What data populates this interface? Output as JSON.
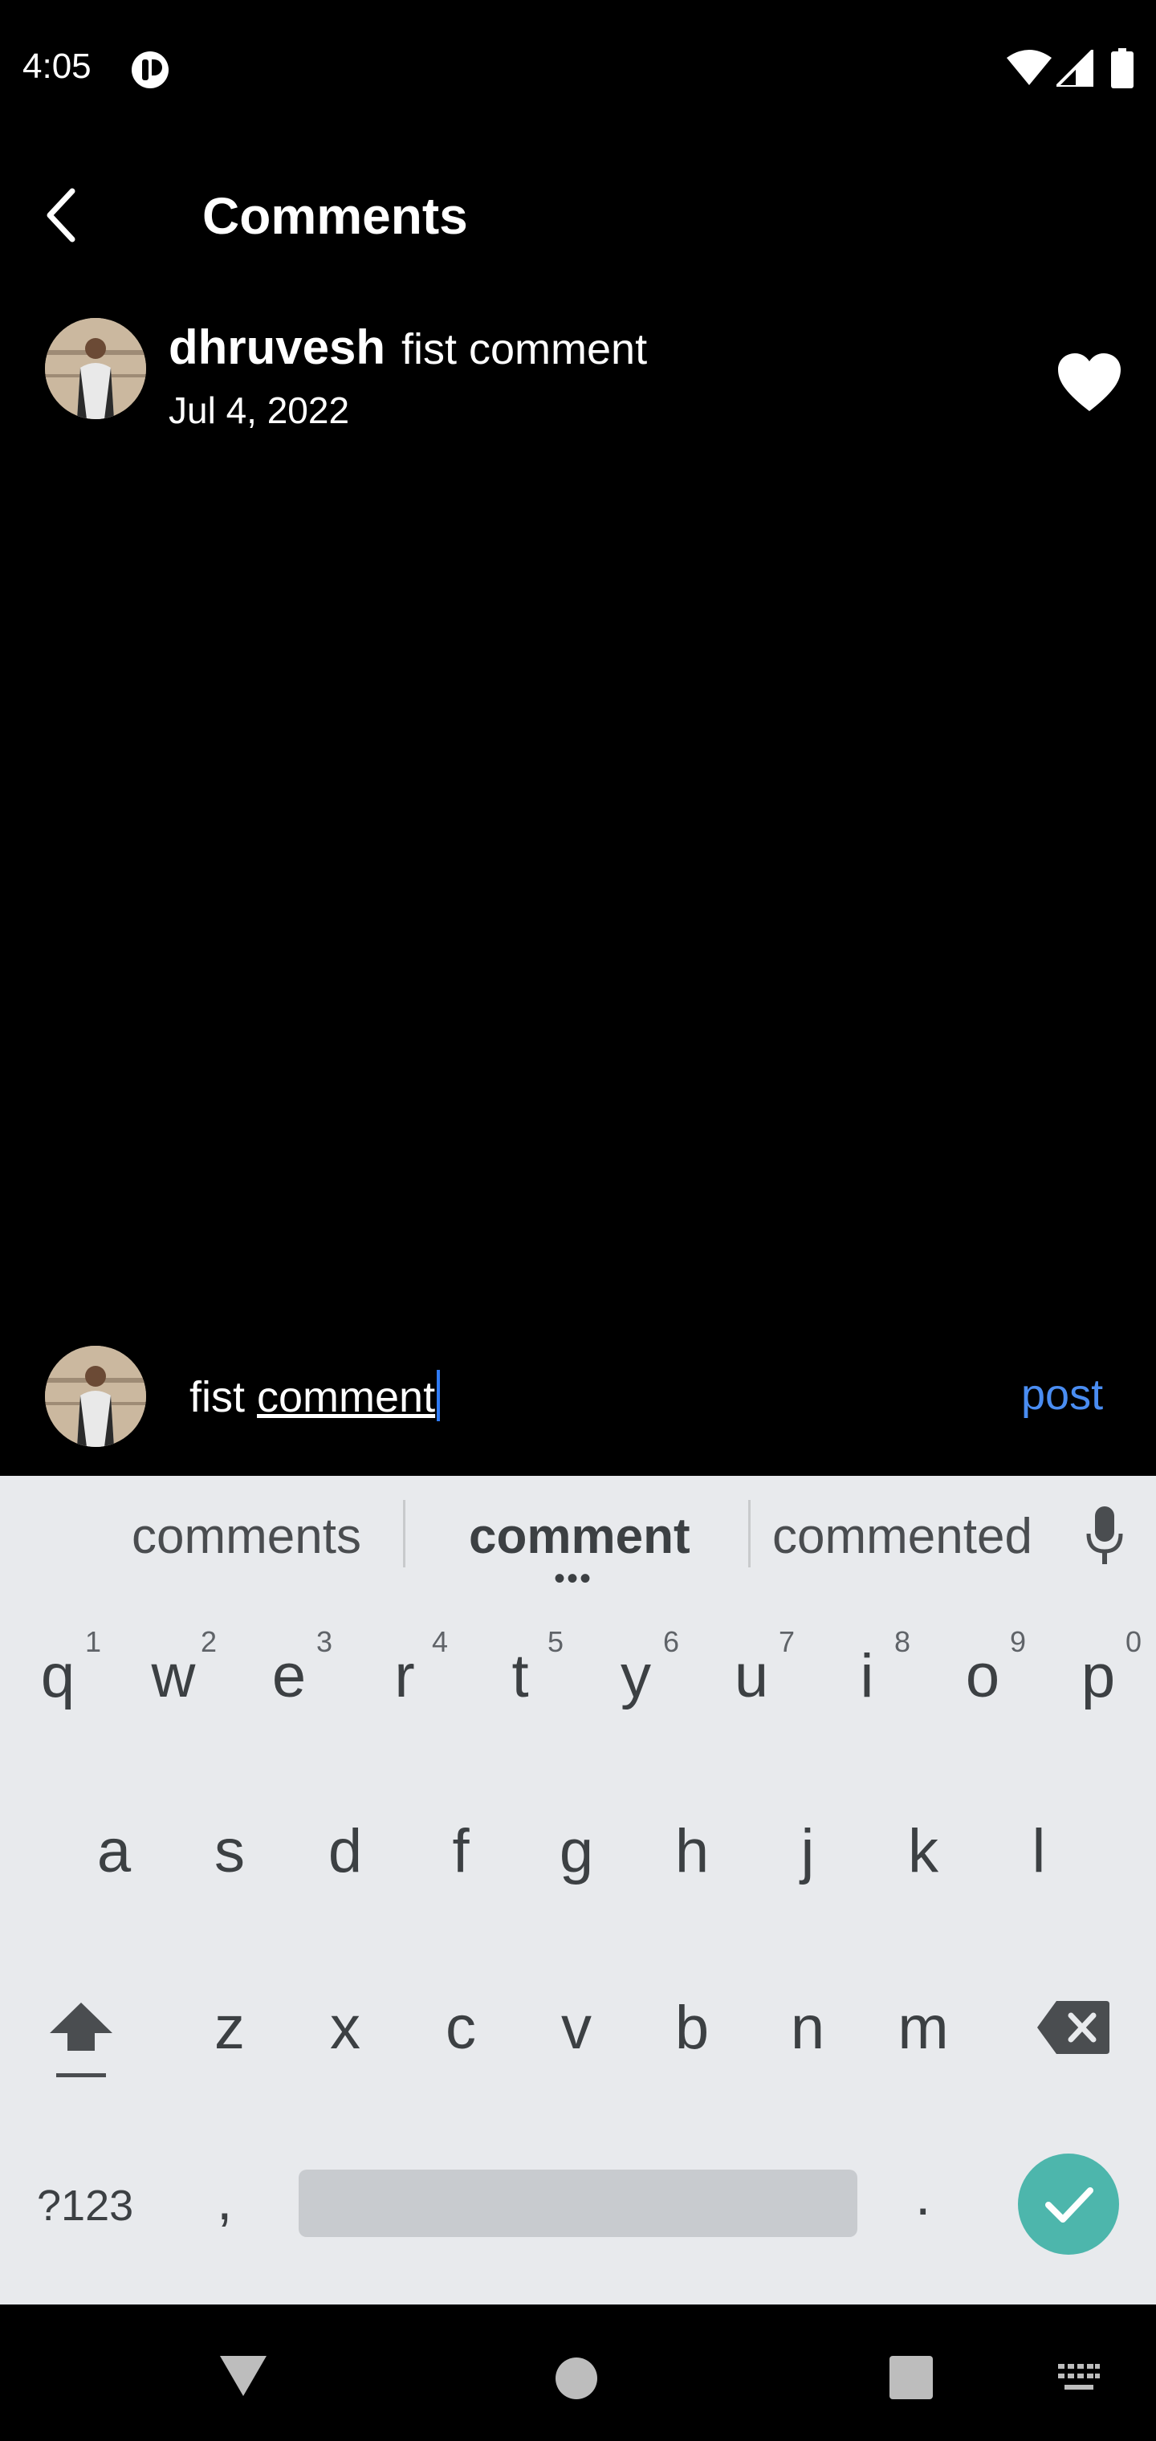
{
  "status_bar": {
    "time": "4:05"
  },
  "header": {
    "title": "Comments"
  },
  "comment": {
    "username": "dhruvesh",
    "text": "fist comment",
    "date": "Jul 4, 2022"
  },
  "composer": {
    "input_plain": "fist ",
    "input_underlined": "comment",
    "post_label": "post"
  },
  "keyboard": {
    "suggestions": [
      "comments",
      "comment",
      "commented"
    ],
    "row1": [
      "q",
      "w",
      "e",
      "r",
      "t",
      "y",
      "u",
      "i",
      "o",
      "p"
    ],
    "row1_numbers": [
      "1",
      "2",
      "3",
      "4",
      "5",
      "6",
      "7",
      "8",
      "9",
      "0"
    ],
    "row2": [
      "a",
      "s",
      "d",
      "f",
      "g",
      "h",
      "j",
      "k",
      "l"
    ],
    "row3": [
      "z",
      "x",
      "c",
      "v",
      "b",
      "n",
      "m"
    ],
    "symbols_label": "?123",
    "comma": ",",
    "period": "."
  },
  "colors": {
    "background": "#000000",
    "accent_link": "#4a8df2",
    "keyboard_bg": "#e8eaed",
    "enter_key": "#4db6ac",
    "cursor": "#2f7bf6"
  },
  "icons": {
    "back": "chevron-left-icon",
    "like": "heart-icon",
    "mic": "microphone-icon",
    "shift": "shift-icon",
    "backspace": "backspace-icon",
    "enter": "checkmark-icon"
  }
}
